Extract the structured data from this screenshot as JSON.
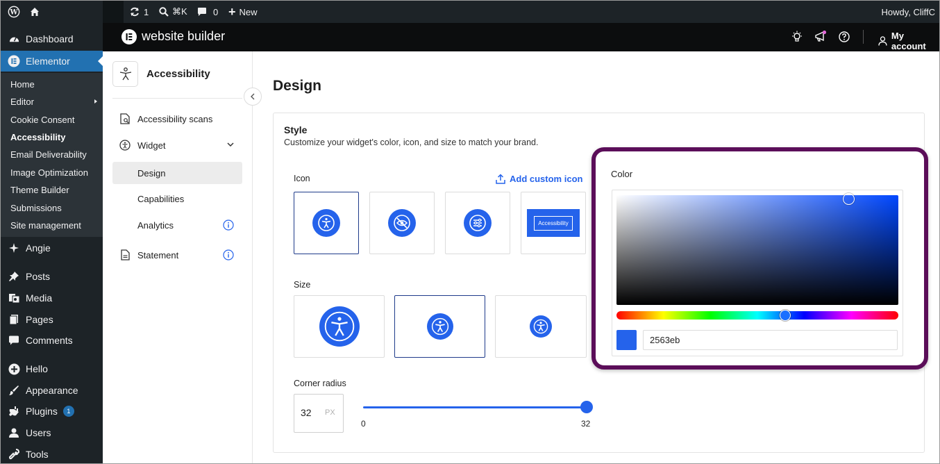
{
  "admin_bar": {
    "updates_count": "1",
    "search_shortcut": "⌘K",
    "comments_count": "0",
    "new_label": "New",
    "howdy": "Howdy, CliffC"
  },
  "sidebar": {
    "dashboard": "Dashboard",
    "elementor": "Elementor",
    "submenu": [
      "Home",
      "Editor",
      "Cookie Consent",
      "Accessibility",
      "Email Deliverability",
      "Image Optimization",
      "Theme Builder",
      "Submissions",
      "Site management"
    ],
    "angie": "Angie",
    "posts": "Posts",
    "media": "Media",
    "pages": "Pages",
    "comments": "Comments",
    "hello": "Hello",
    "appearance": "Appearance",
    "plugins": "Plugins",
    "plugins_badge": "1",
    "users": "Users",
    "tools": "Tools"
  },
  "header": {
    "brand": "website builder",
    "my_account": "My account"
  },
  "subnav": {
    "app_title": "Accessibility",
    "items": [
      "Accessibility scans",
      "Widget",
      "Design",
      "Capabilities",
      "Analytics",
      "Statement"
    ]
  },
  "main": {
    "page_title": "Design",
    "style_title": "Style",
    "style_subtitle": "Customize your widget's color, icon, and size to match your brand.",
    "icon_label": "Icon",
    "add_custom_icon": "Add custom icon",
    "icon_text_button": "Accessibility",
    "size_label": "Size",
    "corner_radius_label": "Corner radius",
    "corner_radius_value": "32",
    "corner_radius_unit": "PX",
    "slider_min": "0",
    "slider_max": "32"
  },
  "color_picker": {
    "label": "Color",
    "hex": "2563eb",
    "swatch_color": "#2563eb"
  },
  "colors": {
    "accent": "#2563eb",
    "admin_bg": "#1d2327",
    "wp_blue": "#2271b1",
    "highlight_border": "#5b0e59"
  }
}
